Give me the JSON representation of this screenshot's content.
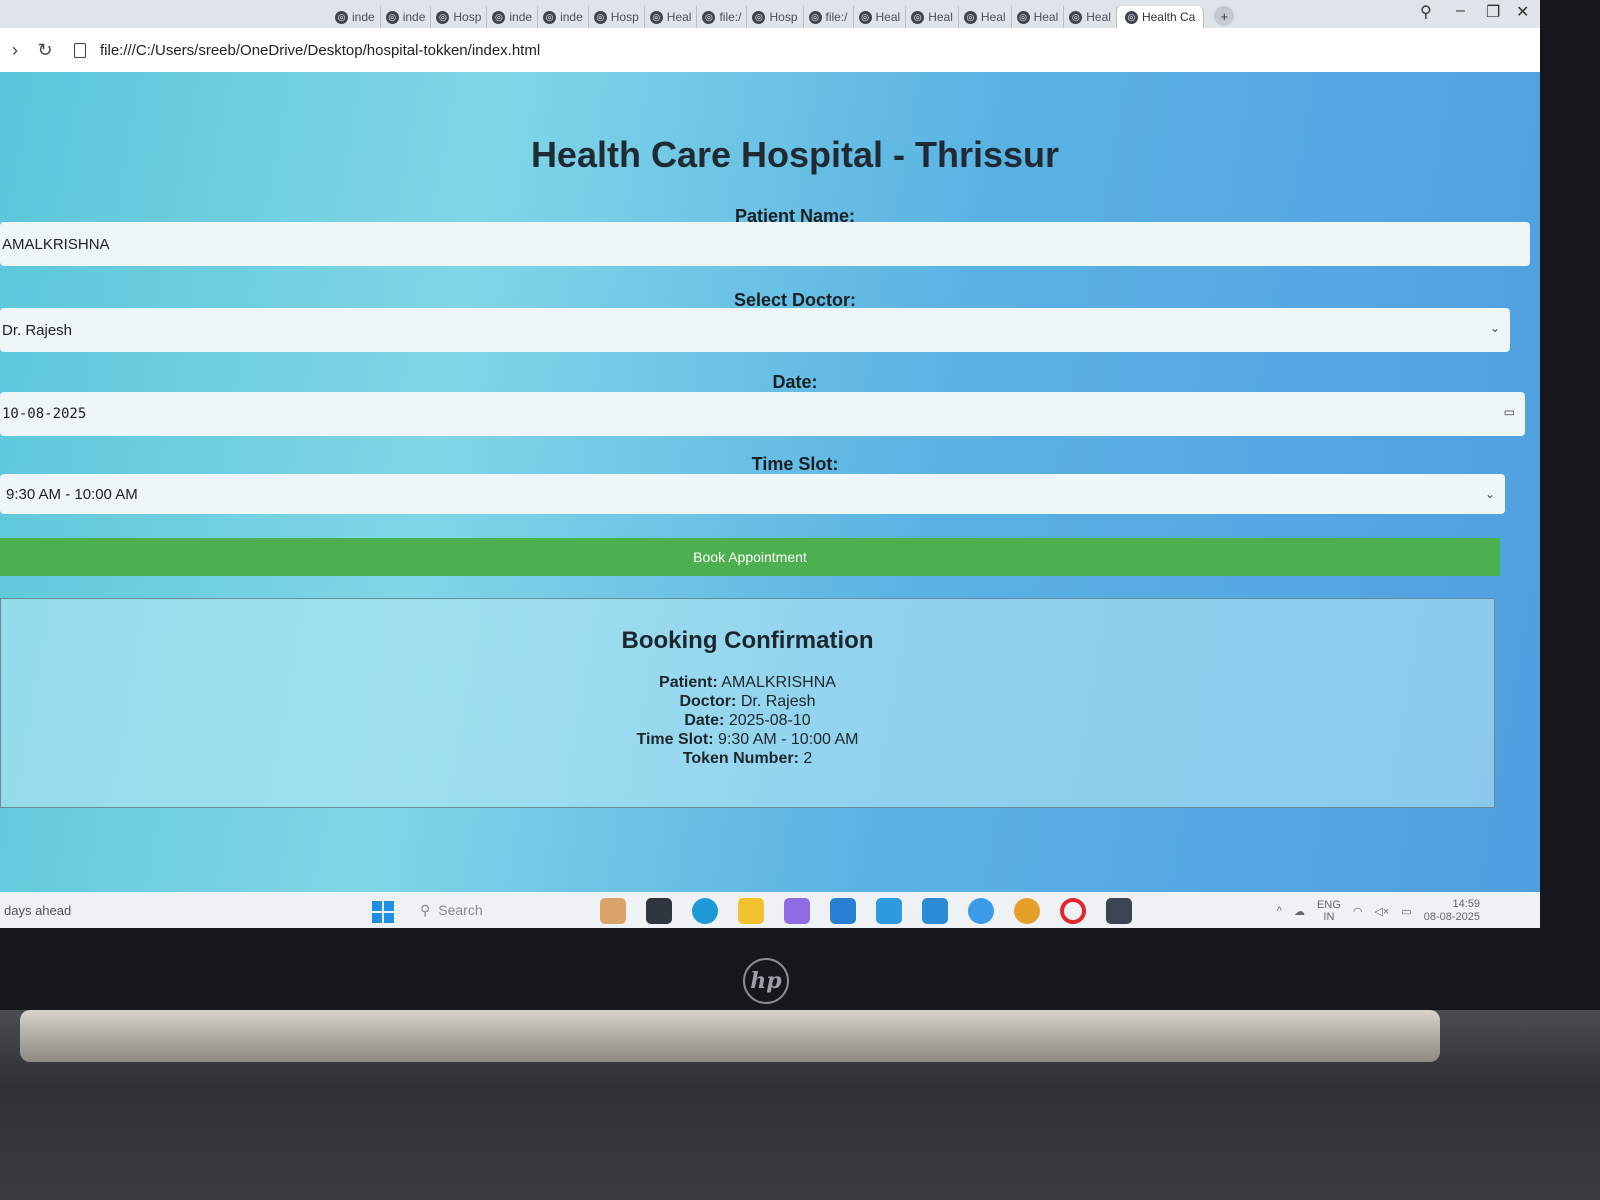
{
  "browser": {
    "tabs": [
      {
        "label": "inde"
      },
      {
        "label": "inde"
      },
      {
        "label": "Hosp"
      },
      {
        "label": "inde"
      },
      {
        "label": "inde"
      },
      {
        "label": "Hosp"
      },
      {
        "label": "Heal"
      },
      {
        "label": "file:/"
      },
      {
        "label": "Hosp"
      },
      {
        "label": "file:/"
      },
      {
        "label": "Heal"
      },
      {
        "label": "Heal"
      },
      {
        "label": "Heal"
      },
      {
        "label": "Heal"
      },
      {
        "label": "Heal"
      }
    ],
    "active_tab": "Health Ca",
    "url": "file:///C:/Users/sreeb/OneDrive/Desktop/hospital-tokken/index.html"
  },
  "page": {
    "title": "Health Care Hospital - Thrissur",
    "patient_label": "Patient Name:",
    "patient_value": "AMALKRISHNA",
    "doctor_label": "Select Doctor:",
    "doctor_value": "Dr. Rajesh",
    "date_label": "Date:",
    "date_value": "10-08-2025",
    "timeslot_label": "Time Slot:",
    "timeslot_value": "9:30 AM - 10:00 AM",
    "book_button": "Book Appointment"
  },
  "confirmation": {
    "title": "Booking Confirmation",
    "patient_key": "Patient:",
    "patient": "AMALKRISHNA",
    "doctor_key": "Doctor:",
    "doctor": "Dr. Rajesh",
    "date_key": "Date:",
    "date": "2025-08-10",
    "timeslot_key": "Time Slot:",
    "timeslot": "9:30 AM - 10:00 AM",
    "token_key": "Token Number:",
    "token": "2"
  },
  "taskbar": {
    "weather": "days ahead",
    "search_placeholder": "Search",
    "lang_1": "ENG",
    "lang_2": "IN",
    "time": "14:59",
    "date": "08-08-2025"
  },
  "colors": {
    "book_button": "#4caf50",
    "page_bg": "#5bc6da"
  }
}
